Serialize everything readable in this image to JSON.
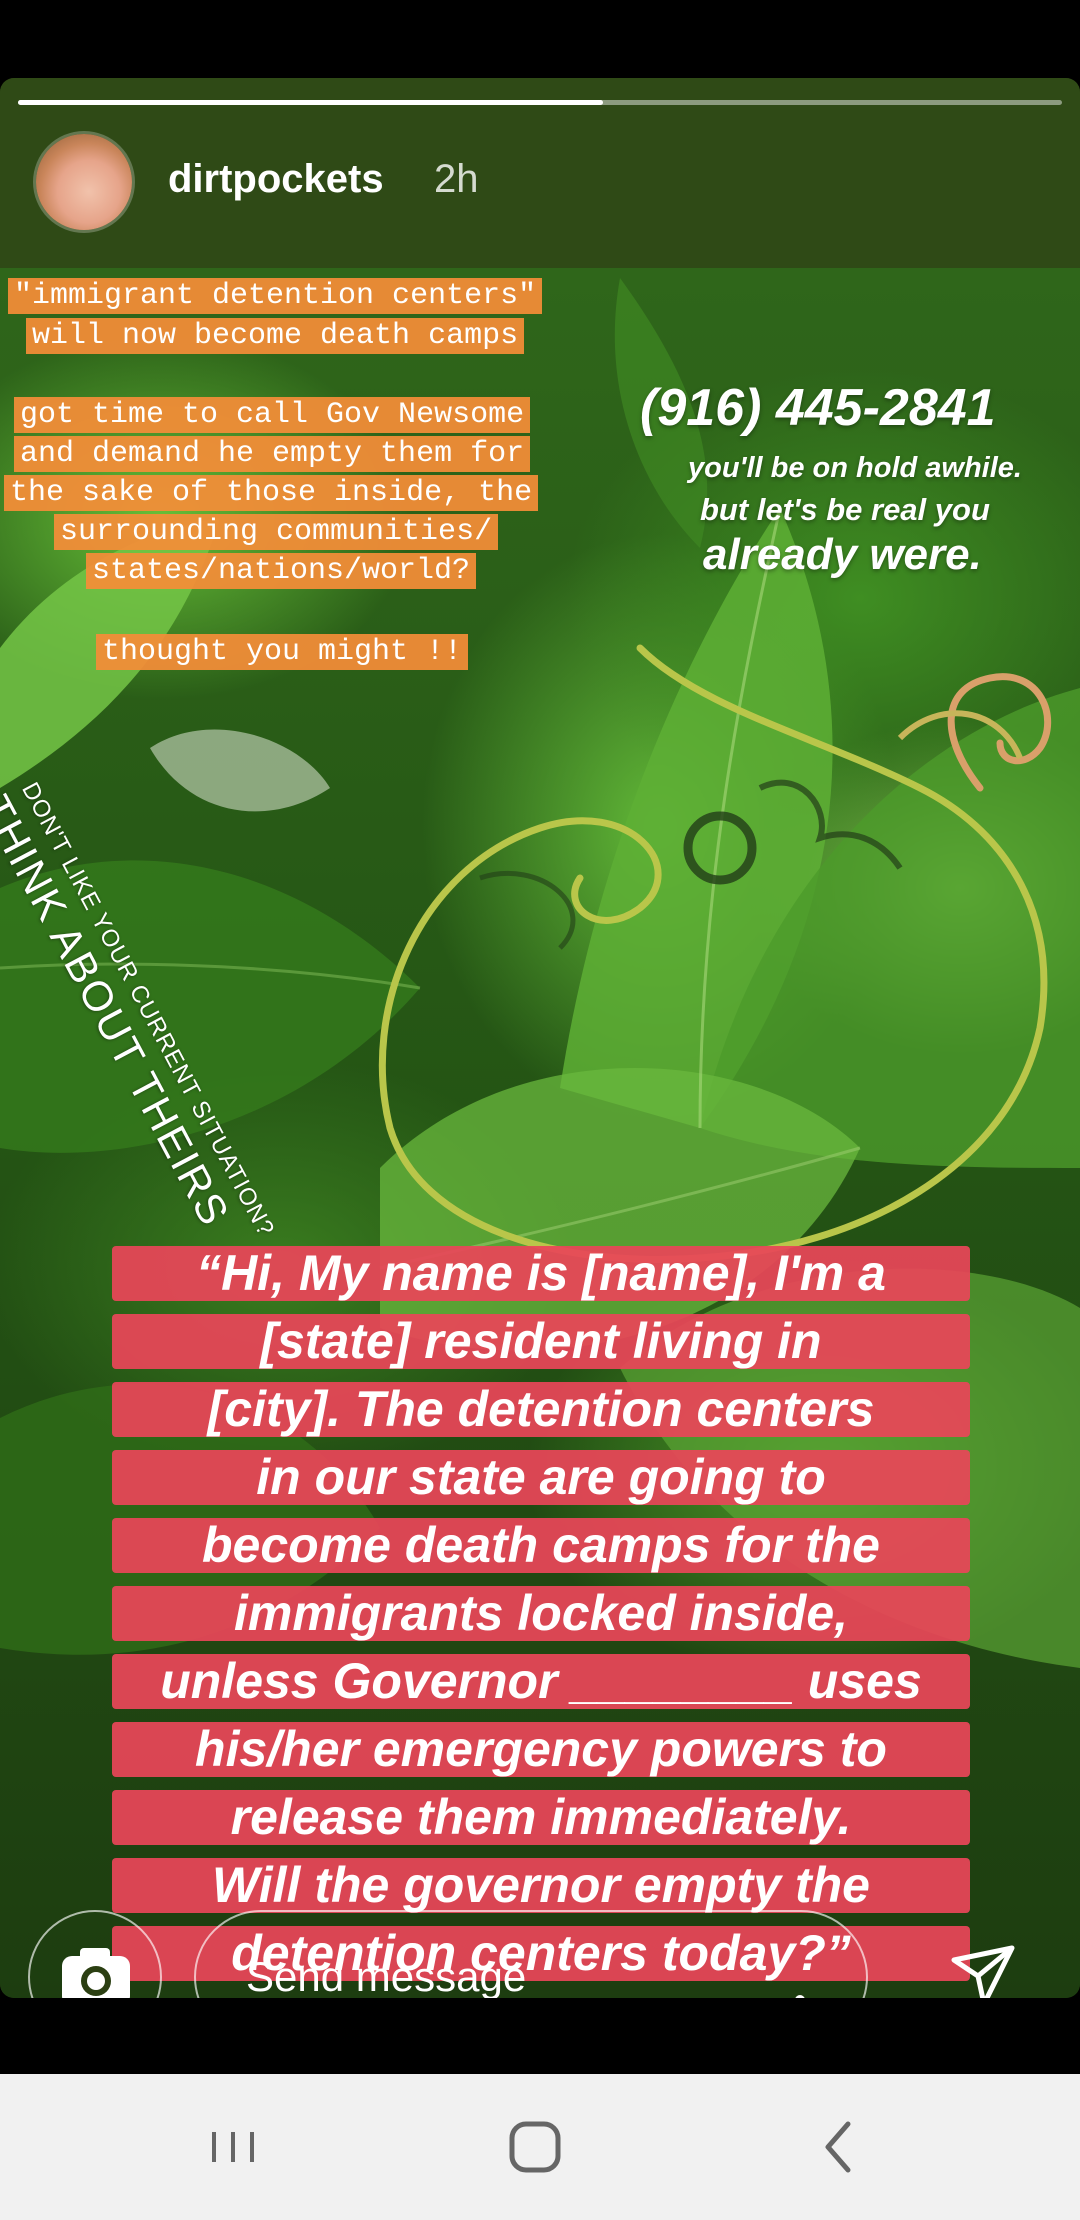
{
  "story": {
    "username": "dirtpockets",
    "timestamp": "2h",
    "progress": 0.56
  },
  "orange_text": {
    "lines": [
      "\"immigrant detention centers\"",
      "will now become death camps",
      "got time to call Gov Newsome",
      "and demand he empty them for",
      "the sake of those inside, the",
      "surrounding communities/",
      "states/nations/world?",
      "thought you might !!"
    ]
  },
  "call_info": {
    "phone": "(916) 445-2841",
    "line1": "you'll be on hold awhile.",
    "line2": "but let's be real you",
    "line3": "already were."
  },
  "rotated_text": {
    "small": "DON'T LIKE YOUR CURRENT SITUATION?",
    "big": "THINK ABOUT THEIRS"
  },
  "script_text": {
    "lines": [
      "“Hi, My name is [name], I'm a",
      "[state] resident living in",
      "[city]. The detention centers",
      "in our state are going to",
      "become death camps for the",
      "immigrants locked inside,",
      "unless Governor ________ uses",
      "his/her emergency powers to",
      "release them immediately.",
      "Will the governor empty the",
      "detention centers today?”"
    ]
  },
  "reply_bar": {
    "placeholder": "Send message",
    "camera_icon": "camera-icon",
    "send_icon": "send-icon"
  },
  "nav_bar": {
    "icons": [
      "recent-apps-icon",
      "home-icon",
      "back-icon"
    ]
  },
  "colors": {
    "orange_highlight": "#f48d38",
    "red_highlight": "#e84658",
    "nav_bar": "#f1f1f1"
  }
}
